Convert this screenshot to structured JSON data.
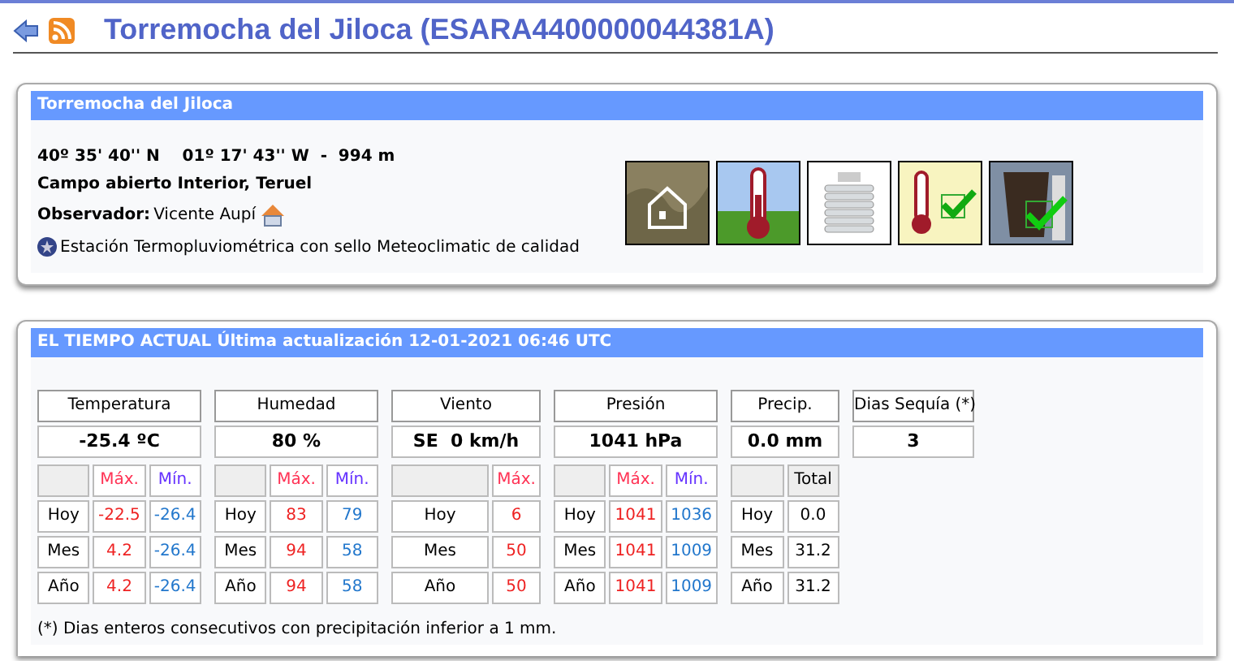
{
  "title": "Torremocha del Jiloca (ESARA4400000044381A)",
  "station": {
    "header": "Torremocha del Jiloca",
    "coordinates": "40º 35' 40'' N    01º 17' 43'' W  -  994 m",
    "location": "Campo abierto Interior, Teruel",
    "observer_label": "Observador:",
    "observer": "Vicente Aupí",
    "quality_note": "Estación Termopluviométrica con sello Meteoclimatic de calidad"
  },
  "current": {
    "header": "EL TIEMPO ACTUAL Última actualización 12-01-2021 06:46 UTC",
    "groups": [
      {
        "kind": "min-max",
        "title": "Temperatura",
        "value": "-25.4 ºC",
        "columns": [
          {
            "label": "Máx.",
            "kind": "max"
          },
          {
            "label": "Mín.",
            "kind": "min"
          }
        ],
        "rows": [
          {
            "label": "Hoy",
            "values": [
              "-22.5",
              "-26.4"
            ]
          },
          {
            "label": "Mes",
            "values": [
              "4.2",
              "-26.4"
            ]
          },
          {
            "label": "Año",
            "values": [
              "4.2",
              "-26.4"
            ]
          }
        ]
      },
      {
        "kind": "min-max",
        "title": "Humedad",
        "value": "80 %",
        "columns": [
          {
            "label": "Máx.",
            "kind": "max"
          },
          {
            "label": "Mín.",
            "kind": "min"
          }
        ],
        "rows": [
          {
            "label": "Hoy",
            "values": [
              "83",
              "79"
            ]
          },
          {
            "label": "Mes",
            "values": [
              "94",
              "58"
            ]
          },
          {
            "label": "Año",
            "values": [
              "94",
              "58"
            ]
          }
        ]
      },
      {
        "kind": "max-only",
        "title": "Viento",
        "value": "SE  0 km/h",
        "columns": [
          {
            "label": "Máx.",
            "kind": "max"
          }
        ],
        "rows": [
          {
            "label": "Hoy",
            "values": [
              "6"
            ]
          },
          {
            "label": "Mes",
            "values": [
              "50"
            ]
          },
          {
            "label": "Año",
            "values": [
              "50"
            ]
          }
        ]
      },
      {
        "kind": "min-max",
        "title": "Presión",
        "value": "1041 hPa",
        "columns": [
          {
            "label": "Máx.",
            "kind": "max"
          },
          {
            "label": "Mín.",
            "kind": "min"
          }
        ],
        "rows": [
          {
            "label": "Hoy",
            "values": [
              "1041",
              "1036"
            ]
          },
          {
            "label": "Mes",
            "values": [
              "1041",
              "1009"
            ]
          },
          {
            "label": "Año",
            "values": [
              "1041",
              "1009"
            ]
          }
        ]
      },
      {
        "kind": "total",
        "title": "Precip.",
        "value": "0.0 mm",
        "columns": [
          {
            "label": "Total",
            "kind": "total"
          }
        ],
        "rows": [
          {
            "label": "Hoy",
            "values": [
              "0.0"
            ]
          },
          {
            "label": "Mes",
            "values": [
              "31.2"
            ]
          },
          {
            "label": "Año",
            "values": [
              "31.2"
            ]
          }
        ]
      },
      {
        "kind": "value-only",
        "title": "Dias Sequía (*)",
        "value": "3"
      }
    ],
    "footnote": "(*) Dias enteros consecutivos con precipitación inferior a 1 mm."
  }
}
